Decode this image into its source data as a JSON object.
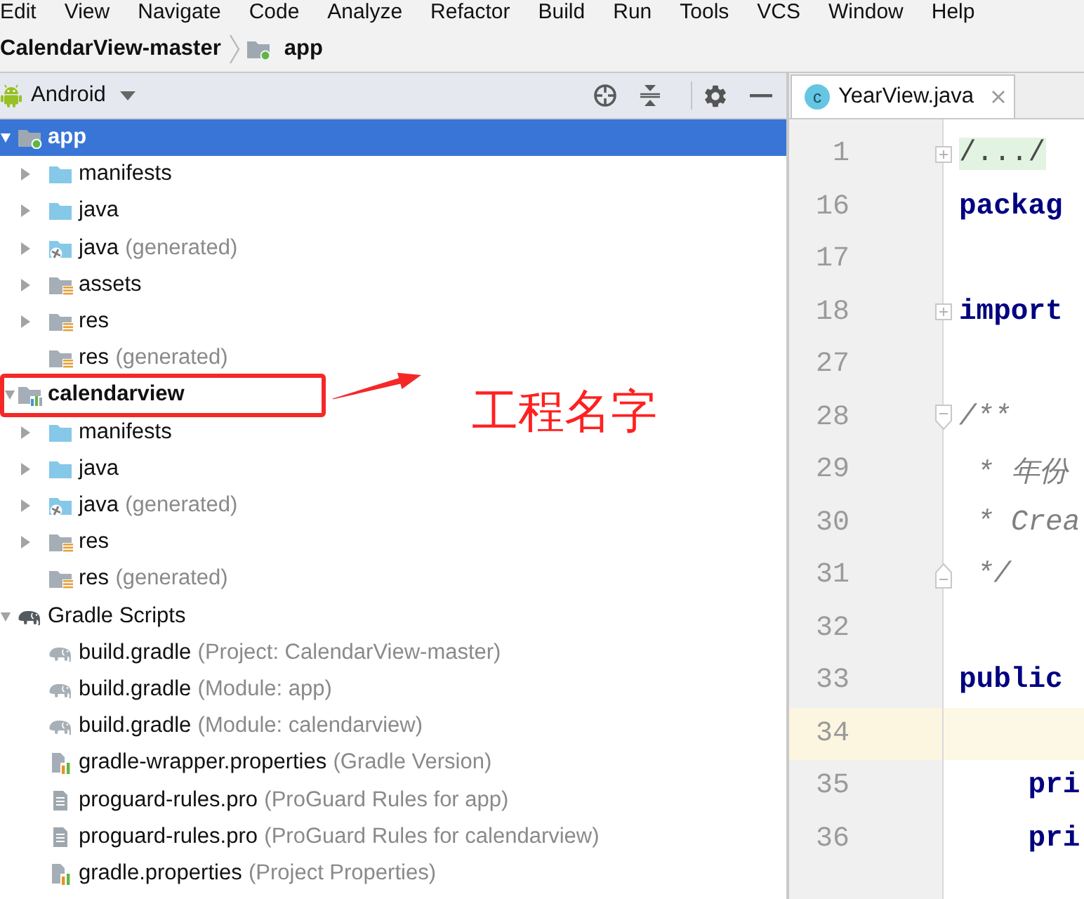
{
  "menu_bar": {
    "items": [
      "Edit",
      "View",
      "Navigate",
      "Code",
      "Analyze",
      "Refactor",
      "Build",
      "Run",
      "Tools",
      "VCS",
      "Window",
      "Help"
    ]
  },
  "breadcrumb": [
    {
      "label": "CalendarView-master",
      "kind": "project"
    },
    {
      "label": "app",
      "kind": "module"
    }
  ],
  "project_panel": {
    "view": "Android",
    "tree": [
      {
        "label": "app",
        "kind": "module",
        "selected": true,
        "expanded": true,
        "children": [
          {
            "label": "manifests",
            "kind": "folder",
            "selected": false,
            "expanded": false
          },
          {
            "label": "java",
            "kind": "folder",
            "selected": false,
            "expanded": false
          },
          {
            "label": "java",
            "note": "(generated)",
            "kind": "generated",
            "selected": false,
            "expanded": false
          },
          {
            "label": "assets",
            "kind": "resources",
            "selected": false,
            "expanded": false
          },
          {
            "label": "res",
            "kind": "resources",
            "selected": false,
            "expanded": false
          },
          {
            "label": "res",
            "note": "(generated)",
            "kind": "resources",
            "selected": false
          }
        ]
      },
      {
        "label": "calendarview",
        "kind": "library",
        "selected": false,
        "expanded": true,
        "annotation": "工程名字",
        "children": [
          {
            "label": "manifests",
            "kind": "folder",
            "selected": false,
            "expanded": false
          },
          {
            "label": "java",
            "kind": "folder",
            "selected": false,
            "expanded": false
          },
          {
            "label": "java",
            "note": "(generated)",
            "kind": "generated",
            "selected": false,
            "expanded": false
          },
          {
            "label": "res",
            "kind": "resources",
            "selected": false,
            "expanded": false
          },
          {
            "label": "res",
            "note": "(generated)",
            "kind": "resources",
            "selected": false
          }
        ]
      },
      {
        "label": "Gradle Scripts",
        "kind": "gradle",
        "selected": false,
        "expanded": true,
        "children": [
          {
            "label": "build.gradle",
            "note": "(Project: CalendarView-master)",
            "kind": "gradle_file",
            "selected": false
          },
          {
            "label": "build.gradle",
            "note": "(Module: app)",
            "kind": "gradle_file",
            "selected": false
          },
          {
            "label": "build.gradle",
            "note": "(Module: calendarview)",
            "kind": "gradle_file",
            "selected": false
          },
          {
            "label": "gradle-wrapper.properties",
            "note": "(Gradle Version)",
            "kind": "properties",
            "selected": false
          },
          {
            "label": "proguard-rules.pro",
            "note": "(ProGuard Rules for app)",
            "kind": "text",
            "selected": false
          },
          {
            "label": "proguard-rules.pro",
            "note": "(ProGuard Rules for calendarview)",
            "kind": "text",
            "selected": false
          },
          {
            "label": "gradle.properties",
            "note": "(Project Properties)",
            "kind": "properties",
            "selected": false
          }
        ]
      }
    ]
  },
  "editor": {
    "tabs": [
      {
        "label": "YearView.java",
        "icon_letter": "c",
        "selected": true
      }
    ],
    "lines": [
      {
        "number": "1",
        "text": "/.../",
        "kind": "folded",
        "fold_marker": {
          "kind": "plus"
        },
        "current": false
      },
      {
        "number": "16",
        "text": "packag",
        "kind": "keyword",
        "current": false
      },
      {
        "number": "17",
        "current": false
      },
      {
        "number": "18",
        "text": "import",
        "kind": "keyword",
        "fold_marker": {
          "kind": "plus"
        },
        "current": false
      },
      {
        "number": "27",
        "current": false
      },
      {
        "number": "28",
        "text": "/**",
        "kind": "comment",
        "fold_marker": {
          "kind": "start"
        },
        "current": false
      },
      {
        "number": "29",
        "text": " * 年份",
        "kind": "comment",
        "current": false
      },
      {
        "number": "30",
        "text": " * Crea",
        "kind": "comment",
        "current": false
      },
      {
        "number": "31",
        "text": " */",
        "kind": "comment",
        "fold_marker": {
          "kind": "end"
        },
        "current": false
      },
      {
        "number": "32",
        "current": false
      },
      {
        "number": "33",
        "text": "public",
        "kind": "keyword",
        "current": false
      },
      {
        "number": "34",
        "current": true
      },
      {
        "number": "35",
        "text": "    pri",
        "kind": "keyword",
        "current": false
      },
      {
        "number": "36",
        "text": "    pri",
        "kind": "keyword",
        "current": false
      }
    ]
  }
}
